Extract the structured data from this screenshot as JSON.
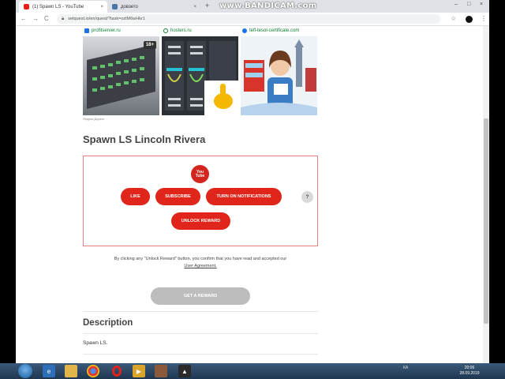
{
  "browser": {
    "tabs": [
      {
        "label": "(1) Spawn LS - YouTube",
        "close": "×"
      },
      {
        "label": "довзето",
        "close": "×"
      }
    ],
    "new_tab": "+",
    "watermark": "www.BANDICAM.com",
    "window_controls": {
      "minimize": "–",
      "maximize": "□",
      "close": "×"
    },
    "nav": {
      "back": "←",
      "forward": "→",
      "reload": "C"
    },
    "url": "setquest.io/en/quest/?task=oztM6wHkr1",
    "star": "☆",
    "menu": "⋮"
  },
  "ads": {
    "items": [
      {
        "domain": "profitserver.ru",
        "badge": "18+"
      },
      {
        "domain": "hosters.ru"
      },
      {
        "domain": "tefl-tesol-certificate.com"
      }
    ],
    "provider": "Яндекс.Директ"
  },
  "page": {
    "title": "Spawn LS Lincoln Rivera",
    "youtube_logo": [
      "You",
      "Tube"
    ],
    "actions": {
      "like": "LIKE",
      "subscribe": "SUBSCRIBE",
      "notifications": "TURN ON NOTIFICATIONS",
      "help": "?",
      "unlock": "UNLOCK REWARD"
    },
    "consent_text": "By clicking any \"Unlock Reward\" button, you confirm that you have read and accepted our",
    "consent_link": "User Agreement.",
    "get_reward": "GET A REWARD",
    "description_title": "Description",
    "description_text": "Spawn LS."
  },
  "taskbar": {
    "tray_lang": "КА",
    "time": "20:06",
    "date": "28.09.2019"
  },
  "colors": {
    "accent_red": "#e0261b",
    "youtube_red": "#d3261f",
    "disabled_gray": "#bdbdbd"
  }
}
